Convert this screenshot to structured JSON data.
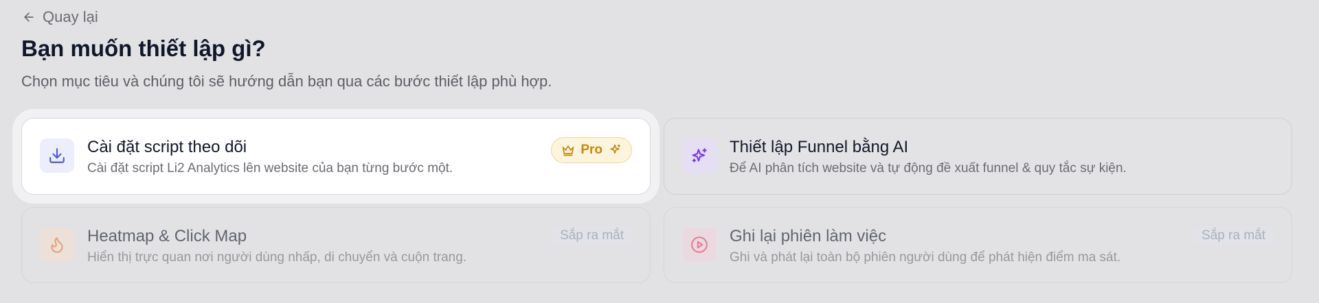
{
  "header": {
    "back_label": "Quay lại",
    "title": "Bạn muốn thiết lập gì?",
    "subtitle": "Chọn mục tiêu và chúng tôi sẽ hướng dẫn bạn qua các bước thiết lập phù hợp."
  },
  "options": [
    {
      "title": "Cài đặt script theo dõi",
      "description": "Cài đặt script Li2 Analytics lên website của bạn từng bước một.",
      "badge": "Pro",
      "icon": "download-icon",
      "icon_color": "#4f5bd5",
      "state": "selected"
    },
    {
      "title": "Thiết lập Funnel bằng AI",
      "description": "Để AI phân tích website và tự động đề xuất funnel & quy tắc sự kiện.",
      "icon": "sparkles-icon",
      "icon_color": "#7c3aed",
      "state": "available"
    },
    {
      "title": "Heatmap & Click Map",
      "description": "Hiển thị trực quan nơi người dùng nhấp, di chuyển và cuộn trang.",
      "badge": "Sắp ra mắt",
      "icon": "flame-icon",
      "icon_color": "#ea7a3f",
      "state": "disabled"
    },
    {
      "title": "Ghi lại phiên làm việc",
      "description": "Ghi và phát lại toàn bộ phiên người dùng để phát hiện điểm ma sát.",
      "badge": "Sắp ra mắt",
      "icon": "play-circle-icon",
      "icon_color": "#e2466e",
      "state": "disabled"
    }
  ],
  "colors": {
    "pro_badge": "#c8880b",
    "soon_badge_text": "#8a93a8",
    "page_background": "#e2e2e4"
  }
}
